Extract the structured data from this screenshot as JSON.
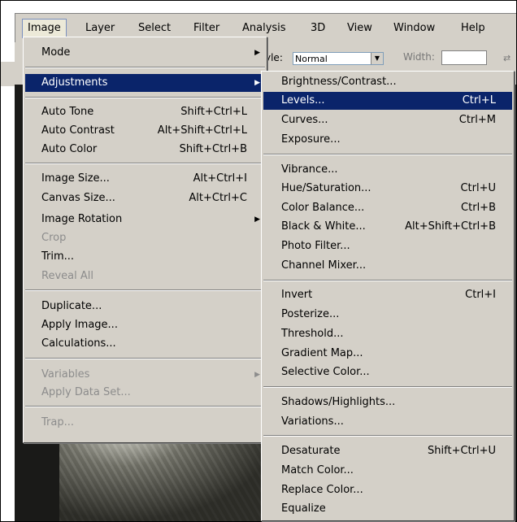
{
  "menubar": {
    "items": [
      "Image",
      "Layer",
      "Select",
      "Filter",
      "Analysis",
      "3D",
      "View",
      "Window",
      "Help"
    ]
  },
  "toolbar": {
    "style_label": "yle:",
    "style_value": "Normal",
    "width_label": "Width:"
  },
  "image_menu": {
    "mode": "Mode",
    "adjustments": "Adjustments",
    "auto_tone": {
      "label": "Auto Tone",
      "shortcut": "Shift+Ctrl+L"
    },
    "auto_contrast": {
      "label": "Auto Contrast",
      "shortcut": "Alt+Shift+Ctrl+L"
    },
    "auto_color": {
      "label": "Auto Color",
      "shortcut": "Shift+Ctrl+B"
    },
    "image_size": {
      "label": "Image Size...",
      "shortcut": "Alt+Ctrl+I"
    },
    "canvas_size": {
      "label": "Canvas Size...",
      "shortcut": "Alt+Ctrl+C"
    },
    "image_rotation": "Image Rotation",
    "crop": "Crop",
    "trim": "Trim...",
    "reveal_all": "Reveal All",
    "duplicate": "Duplicate...",
    "apply_image": "Apply Image...",
    "calculations": "Calculations...",
    "variables": "Variables",
    "apply_data_set": "Apply Data Set...",
    "trap": "Trap..."
  },
  "adjustments_menu": {
    "brightness_contrast": {
      "label": "Brightness/Contrast...",
      "shortcut": ""
    },
    "levels": {
      "label": "Levels...",
      "shortcut": "Ctrl+L"
    },
    "curves": {
      "label": "Curves...",
      "shortcut": "Ctrl+M"
    },
    "exposure": {
      "label": "Exposure...",
      "shortcut": ""
    },
    "vibrance": {
      "label": "Vibrance...",
      "shortcut": ""
    },
    "hue_saturation": {
      "label": "Hue/Saturation...",
      "shortcut": "Ctrl+U"
    },
    "color_balance": {
      "label": "Color Balance...",
      "shortcut": "Ctrl+B"
    },
    "black_white": {
      "label": "Black & White...",
      "shortcut": "Alt+Shift+Ctrl+B"
    },
    "photo_filter": {
      "label": "Photo Filter...",
      "shortcut": ""
    },
    "channel_mixer": {
      "label": "Channel Mixer...",
      "shortcut": ""
    },
    "invert": {
      "label": "Invert",
      "shortcut": "Ctrl+I"
    },
    "posterize": {
      "label": "Posterize...",
      "shortcut": ""
    },
    "threshold": {
      "label": "Threshold...",
      "shortcut": ""
    },
    "gradient_map": {
      "label": "Gradient Map...",
      "shortcut": ""
    },
    "selective_color": {
      "label": "Selective Color...",
      "shortcut": ""
    },
    "shadows_highlights": {
      "label": "Shadows/Highlights...",
      "shortcut": ""
    },
    "variations": {
      "label": "Variations...",
      "shortcut": ""
    },
    "desaturate": {
      "label": "Desaturate",
      "shortcut": "Shift+Ctrl+U"
    },
    "match_color": {
      "label": "Match Color...",
      "shortcut": ""
    },
    "replace_color": {
      "label": "Replace Color...",
      "shortcut": ""
    },
    "equalize": {
      "label": "Equalize",
      "shortcut": ""
    }
  },
  "colors": {
    "menu_bg": "#d4d0c8",
    "highlight": "#0a246a",
    "disabled_text": "#8c8c8c"
  }
}
